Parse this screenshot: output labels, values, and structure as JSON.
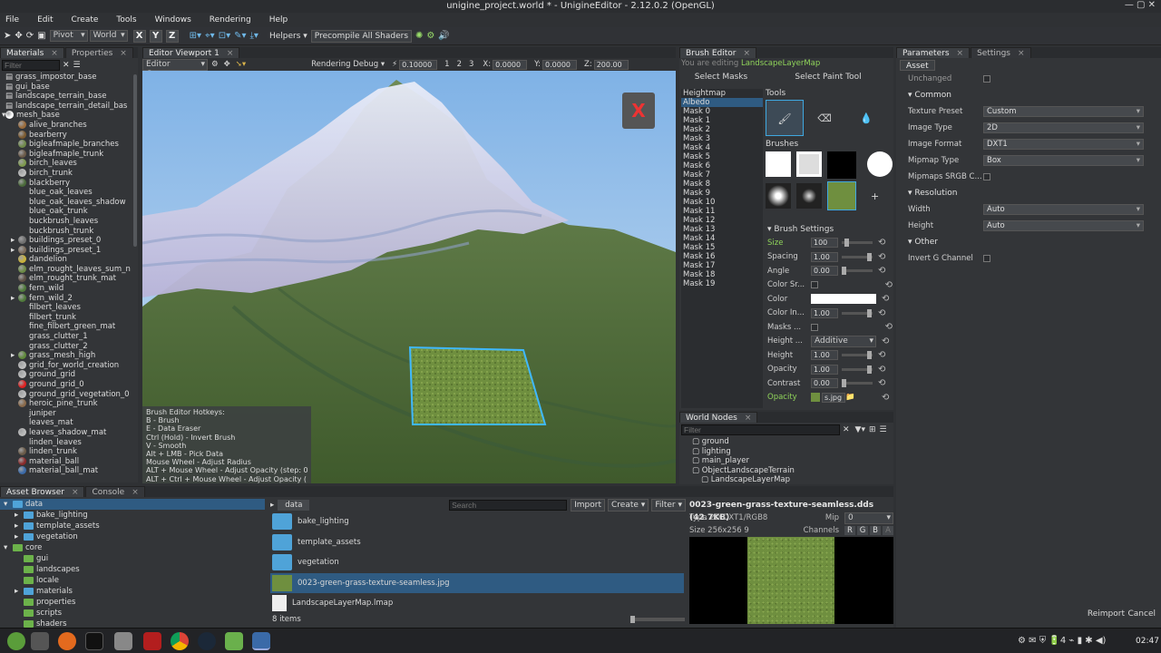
{
  "window": {
    "title": "unigine_project.world * - UnigineEditor - 2.12.0.2 (OpenGL)"
  },
  "menu": [
    "File",
    "Edit",
    "Create",
    "Tools",
    "Windows",
    "Rendering",
    "Help"
  ],
  "toolbar": {
    "pivot": "Pivot",
    "world": "World",
    "x": "X",
    "y": "Y",
    "z": "Z",
    "helpers": "Helpers",
    "precompile": "Precompile All Shaders"
  },
  "left_panel": {
    "tabs": [
      "Materials",
      "Properties"
    ],
    "filter_placeholder": "Filter",
    "items": [
      {
        "label": "grass_impostor_base",
        "kind": "doc",
        "indent": 0
      },
      {
        "label": "gui_base",
        "kind": "doc",
        "indent": 0
      },
      {
        "label": "landscape_terrain_base",
        "kind": "doc",
        "indent": 0
      },
      {
        "label": "landscape_terrain_detail_bas",
        "kind": "doc",
        "indent": 0
      },
      {
        "label": "mesh_base",
        "kind": "sphere",
        "color": "#ffffff",
        "indent": 0,
        "expanded": true
      },
      {
        "label": "alive_branches",
        "kind": "sphere",
        "color": "#9a6b3a",
        "indent": 1
      },
      {
        "label": "bearberry",
        "kind": "sphere",
        "color": "#7b5a2f",
        "indent": 1
      },
      {
        "label": "bigleafmaple_branches",
        "kind": "sphere",
        "color": "#6f8a4a",
        "indent": 1
      },
      {
        "label": "bigleafmaple_trunk",
        "kind": "sphere",
        "color": "#6a5a48",
        "indent": 1
      },
      {
        "label": "birch_leaves",
        "kind": "sphere",
        "color": "#7e9a4e",
        "indent": 1
      },
      {
        "label": "birch_trunk",
        "kind": "sphere",
        "color": "#bdbdbd",
        "indent": 1
      },
      {
        "label": "blackberry",
        "kind": "sphere",
        "color": "#4a6a3a",
        "indent": 1
      },
      {
        "label": "blue_oak_leaves",
        "kind": "none",
        "indent": 1
      },
      {
        "label": "blue_oak_leaves_shadow",
        "kind": "none",
        "indent": 1
      },
      {
        "label": "blue_oak_trunk",
        "kind": "none",
        "indent": 1
      },
      {
        "label": "buckbrush_leaves",
        "kind": "none",
        "indent": 1
      },
      {
        "label": "buckbrush_trunk",
        "kind": "none",
        "indent": 1
      },
      {
        "label": "buildings_preset_0",
        "kind": "sphere",
        "color": "#6f6f6f",
        "indent": 1,
        "arrow": true
      },
      {
        "label": "buildings_preset_1",
        "kind": "sphere",
        "color": "#7a6a5a",
        "indent": 1,
        "arrow": true
      },
      {
        "label": "dandelion",
        "kind": "sphere",
        "color": "#c9b23a",
        "indent": 1
      },
      {
        "label": "elm_rought_leaves_sum_n",
        "kind": "sphere",
        "color": "#6c8a45",
        "indent": 1
      },
      {
        "label": "elm_rought_trunk_mat",
        "kind": "sphere",
        "color": "#5d5045",
        "indent": 1
      },
      {
        "label": "fern_wild",
        "kind": "sphere",
        "color": "#4f7a3a",
        "indent": 1
      },
      {
        "label": "fern_wild_2",
        "kind": "sphere",
        "color": "#4f7a3a",
        "indent": 1,
        "arrow": true
      },
      {
        "label": "filbert_leaves",
        "kind": "none",
        "indent": 1
      },
      {
        "label": "filbert_trunk",
        "kind": "none",
        "indent": 1
      },
      {
        "label": "fine_filbert_green_mat",
        "kind": "none",
        "indent": 1
      },
      {
        "label": "grass_clutter_1",
        "kind": "none",
        "indent": 1
      },
      {
        "label": "grass_clutter_2",
        "kind": "none",
        "indent": 1
      },
      {
        "label": "grass_mesh_high",
        "kind": "sphere",
        "color": "#5f8a3a",
        "indent": 1,
        "arrow": true
      },
      {
        "label": "grid_for_world_creation",
        "kind": "sphere",
        "color": "#bdbdbd",
        "indent": 1
      },
      {
        "label": "ground_grid",
        "kind": "sphere",
        "color": "#bdbdbd",
        "indent": 1
      },
      {
        "label": "ground_grid_0",
        "kind": "sphere",
        "color": "#e02020",
        "indent": 1
      },
      {
        "label": "ground_grid_vegetation_0",
        "kind": "sphere",
        "color": "#bdbdbd",
        "indent": 1
      },
      {
        "label": "heroic_pine_trunk",
        "kind": "sphere",
        "color": "#8a6a4a",
        "indent": 1
      },
      {
        "label": "juniper",
        "kind": "none",
        "indent": 1
      },
      {
        "label": "leaves_mat",
        "kind": "none",
        "indent": 1
      },
      {
        "label": "leaves_shadow_mat",
        "kind": "sphere",
        "color": "#bdbdbd",
        "indent": 1
      },
      {
        "label": "linden_leaves",
        "kind": "none",
        "indent": 1
      },
      {
        "label": "linden_trunk",
        "kind": "sphere",
        "color": "#6a5a48",
        "indent": 1
      },
      {
        "label": "material_ball",
        "kind": "sphere",
        "color": "#8a2a2a",
        "indent": 1
      },
      {
        "label": "material_ball_mat",
        "kind": "sphere",
        "color": "#3a6aa8",
        "indent": 1
      }
    ]
  },
  "viewport": {
    "tab": "Editor Viewport 1",
    "camera": "Editor Camera",
    "rendering_debug": "Rendering Debug",
    "speed": "0.10000",
    "layers": [
      "1",
      "2",
      "3"
    ],
    "x_label": "X:",
    "x_val": "0.0000",
    "y_label": "Y:",
    "y_val": "0.0000",
    "z_label": "Z:",
    "z_val": "200.00",
    "hotkeys": [
      "Brush Editor Hotkeys:",
      "B - Brush",
      "E - Data Eraser",
      "Ctrl (Hold) - Invert Brush",
      "V - Smooth",
      "Alt + LMB - Pick Data",
      "Mouse Wheel - Adjust Radius",
      "ALT + Mouse Wheel -  Adjust Opacity (step: 0",
      "ALT + Ctrl + Mouse Wheel - Adjust Opacity ("
    ]
  },
  "brush_editor": {
    "tab": "Brush Editor",
    "editing_prefix": "You are editing",
    "editing_target": "LandscapeLayerMap",
    "select_masks": "Select Masks",
    "select_tool": "Select Paint Tool",
    "tools_label": "Tools",
    "brushes_label": "Brushes",
    "brush_settings_label": "Brush Settings",
    "masks": [
      "Heightmap",
      "Albedo",
      "Mask 0",
      "Mask 1",
      "Mask 2",
      "Mask 3",
      "Mask 4",
      "Mask 5",
      "Mask 6",
      "Mask 7",
      "Mask 8",
      "Mask 9",
      "Mask 10",
      "Mask 11",
      "Mask 12",
      "Mask 13",
      "Mask 14",
      "Mask 15",
      "Mask 16",
      "Mask 17",
      "Mask 18",
      "Mask 19"
    ],
    "selected_mask": "Albedo",
    "settings": [
      {
        "label": "Size",
        "value": "100",
        "slider": 0.1,
        "highlight": true
      },
      {
        "label": "Spacing",
        "value": "1.00",
        "slider": 0.95
      },
      {
        "label": "Angle",
        "value": "0.00",
        "slider": 0.0
      },
      {
        "label": "Color Sr...",
        "type": "check"
      },
      {
        "label": "Color",
        "type": "color"
      },
      {
        "label": "Color In...",
        "value": "1.00",
        "slider": 0.95
      },
      {
        "label": "Masks ...",
        "type": "check"
      },
      {
        "label": "Height ...",
        "type": "dropdown",
        "value": "Additive"
      },
      {
        "label": "Height",
        "value": "1.00",
        "slider": 0.95
      },
      {
        "label": "Opacity",
        "value": "1.00",
        "slider": 0.95
      },
      {
        "label": "Contrast",
        "value": "0.00",
        "slider": 0.0
      },
      {
        "label": "Opacity",
        "type": "texture",
        "value": "s.jpg",
        "highlight": true
      }
    ]
  },
  "world_nodes": {
    "tab": "World Nodes",
    "filter_placeholder": "Filter",
    "items": [
      {
        "label": "ground",
        "indent": 1
      },
      {
        "label": "lighting",
        "indent": 1
      },
      {
        "label": "main_player",
        "indent": 1
      },
      {
        "label": "ObjectLandscapeTerrain",
        "indent": 1
      },
      {
        "label": "LandscapeLayerMap",
        "indent": 2
      }
    ]
  },
  "parameters": {
    "tabs": [
      "Parameters",
      "Settings"
    ],
    "subtab": "Asset",
    "unchanged": "Unchanged",
    "common": "Common",
    "resolution": "Resolution",
    "other": "Other",
    "rows": [
      {
        "label": "Texture Preset",
        "value": "Custom"
      },
      {
        "label": "Image Type",
        "value": "2D"
      },
      {
        "label": "Image Format",
        "value": "DXT1"
      },
      {
        "label": "Mipmap Type",
        "value": "Box"
      }
    ],
    "mipmaps_srgb": "Mipmaps SRGB C...",
    "res_rows": [
      {
        "label": "Width",
        "value": "Auto"
      },
      {
        "label": "Height",
        "value": "Auto"
      }
    ],
    "invert_g": "Invert G Channel",
    "reimport": "Reimport",
    "cancel": "Cancel"
  },
  "asset_browser": {
    "tabs": [
      "Asset Browser",
      "Console"
    ],
    "tree": [
      {
        "label": "data",
        "indent": 0,
        "arrow": "open",
        "selected": true
      },
      {
        "label": "bake_lighting",
        "indent": 1,
        "arrow": "closed"
      },
      {
        "label": "template_assets",
        "indent": 1,
        "arrow": "closed"
      },
      {
        "label": "vegetation",
        "indent": 1,
        "arrow": "closed"
      },
      {
        "label": "core",
        "indent": 0,
        "arrow": "open"
      },
      {
        "label": "gui",
        "indent": 1
      },
      {
        "label": "landscapes",
        "indent": 1
      },
      {
        "label": "locale",
        "indent": 1
      },
      {
        "label": "materials",
        "indent": 1,
        "arrow": "closed"
      },
      {
        "label": "properties",
        "indent": 1
      },
      {
        "label": "scripts",
        "indent": 1
      },
      {
        "label": "shaders",
        "indent": 1
      }
    ],
    "path": "data",
    "search_placeholder": "Search",
    "import": "Import",
    "create": "Create",
    "filter": "Filter",
    "files": [
      {
        "label": "bake_lighting",
        "kind": "folder"
      },
      {
        "label": "template_assets",
        "kind": "folder"
      },
      {
        "label": "vegetation",
        "kind": "folder"
      },
      {
        "label": "0023-green-grass-texture-seamless.jpg",
        "kind": "image",
        "selected": true
      },
      {
        "label": "LandscapeLayerMap.lmap",
        "kind": "doc"
      }
    ],
    "count": "8 items"
  },
  "preview": {
    "title": "0023-green-grass-texture-seamless.dds (42.7KB)",
    "type_label": "Type",
    "type_value": "2D DXT1/RGB8",
    "mip_label": "Mip",
    "mip_value": "0",
    "size_label": "Size",
    "size_value": "256x256 9",
    "channels_label": "Channels",
    "channels": [
      "R",
      "G",
      "B",
      "A"
    ]
  },
  "taskbar": {
    "clock": "02:47",
    "battery": "4"
  }
}
